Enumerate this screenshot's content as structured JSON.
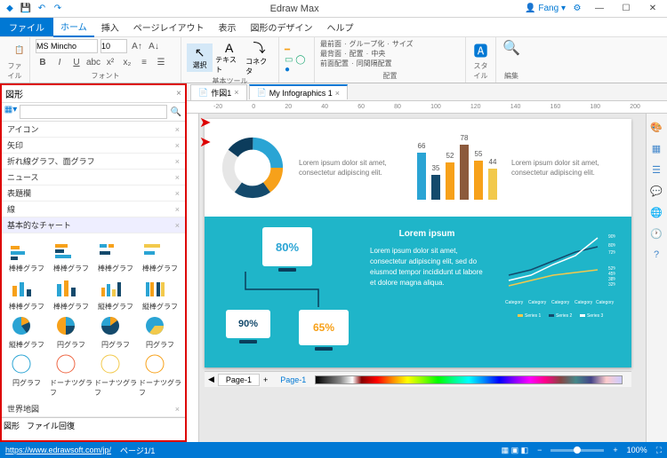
{
  "app": {
    "title": "Edraw Max",
    "user": "Fang"
  },
  "menu": {
    "file": "ファイル",
    "items": [
      "ホーム",
      "挿入",
      "ページレイアウト",
      "表示",
      "図形のデザイン",
      "ヘルプ"
    ]
  },
  "ribbon": {
    "file_label": "ファイル",
    "font_label": "フォント",
    "font_name": "MS Mincho",
    "font_size": "10",
    "tools_label": "基本ツール",
    "select": "選択",
    "text": "テキスト",
    "connector": "コネクタ",
    "arrange_label": "配置",
    "arr": [
      "最前面",
      "グループ化",
      "サイズ",
      "最背面",
      "配置",
      "中央",
      "前面配置",
      "同間隔配置"
    ],
    "style": "スタイル",
    "edit": "編集"
  },
  "shapes": {
    "title": "図形",
    "cats": [
      "アイコン",
      "矢印",
      "折れ線グラフ、面グラフ",
      "ニュース",
      "表題欄",
      "線"
    ],
    "basic_chart": "基本的なチャート",
    "items": [
      "棒棒グラフ",
      "棒棒グラフ",
      "棒棒グラフ",
      "棒棒グラフ",
      "棒棒グラフ",
      "棒棒グラフ",
      "縦棒グラフ",
      "縦棒グラフ",
      "縦棒グラフ",
      "円グラフ",
      "円グラフ",
      "円グラフ",
      "円グラフ",
      "ドーナツグラフ",
      "ドーナツグラフ",
      "ドーナツグラフ"
    ],
    "world": "世界地図",
    "tabs": [
      "図形",
      "ファイル回復"
    ]
  },
  "docs": {
    "tab1": "作図1",
    "tab2": "My Infographics 1"
  },
  "ruler": [
    "-20",
    "0",
    "20",
    "40",
    "60",
    "80",
    "100",
    "120",
    "140",
    "160",
    "180",
    "200"
  ],
  "infographic": {
    "lorem_short": "Lorem ipsum dolor sit amet, consectetur adipiscing elit.",
    "title": "Lorem ipsum",
    "lorem_long": "Lorem ipsum dolor sit amet, consectetur adipiscing elit, sed do eiusmod tempor incididunt ut labore et dolore magna aliqua.",
    "pct1": "80%",
    "pct2": "90%",
    "pct3": "65%",
    "legend": [
      "Category",
      "Category",
      "Category",
      "Category",
      "Category"
    ],
    "series": [
      "Series 1",
      "Series 2",
      "Series 3"
    ],
    "line_ticks": [
      "90%",
      "80%",
      "72%",
      "52%",
      "45%",
      "38%",
      "32%"
    ]
  },
  "chart_data": {
    "donut": {
      "type": "pie",
      "values": [
        25,
        15,
        20,
        25,
        15
      ],
      "colors": [
        "#2aa4d4",
        "#f7a11a",
        "#144a6c",
        "#e6e6e6",
        "#0c3c5c"
      ]
    },
    "bars": {
      "type": "bar",
      "categories": [
        "",
        "",
        "",
        "",
        ""
      ],
      "values": [
        66,
        35,
        52,
        78,
        55,
        44
      ],
      "colors": [
        "#2aa4d4",
        "#144a6c",
        "#f7a11a",
        "#8c5a3c",
        "#f7a11a",
        "#f2c94c"
      ],
      "ylim": [
        0,
        80
      ]
    },
    "line": {
      "type": "line",
      "x": [
        1,
        2,
        3,
        4,
        5
      ],
      "series": [
        {
          "name": "Series 1",
          "values": [
            32,
            38,
            45,
            48,
            52
          ]
        },
        {
          "name": "Series 2",
          "values": [
            45,
            52,
            62,
            72,
            80
          ]
        },
        {
          "name": "Series 3",
          "values": [
            38,
            45,
            58,
            68,
            90
          ]
        }
      ]
    }
  },
  "page_tab": "Page-1",
  "status": {
    "url": "https://www.edrawsoft.com/jp/",
    "page": "ページ1/1",
    "zoom": "100%"
  }
}
